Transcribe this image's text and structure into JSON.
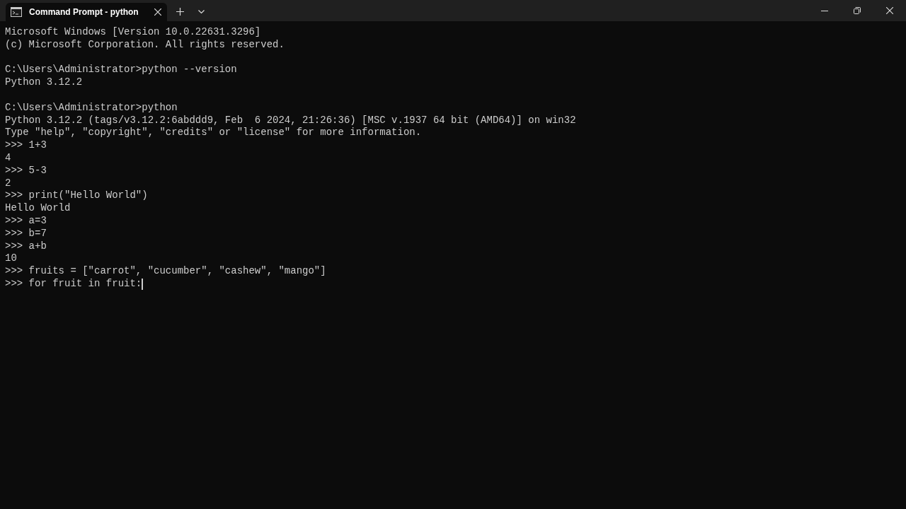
{
  "tabs": [
    {
      "title": "Command Prompt - python",
      "selected": true
    }
  ],
  "terminal": {
    "blocks": [
      [
        "Microsoft Windows [Version 10.0.22631.3296]",
        "(c) Microsoft Corporation. All rights reserved."
      ],
      [
        "C:\\Users\\Administrator>python --version",
        "Python 3.12.2"
      ],
      [
        "C:\\Users\\Administrator>python",
        "Python 3.12.2 (tags/v3.12.2:6abddd9, Feb  6 2024, 21:26:36) [MSC v.1937 64 bit (AMD64)] on win32",
        "Type \"help\", \"copyright\", \"credits\" or \"license\" for more information.",
        ">>> 1+3",
        "4",
        ">>> 5-3",
        "2",
        ">>> print(\"Hello World\")",
        "Hello World",
        ">>> a=3",
        ">>> b=7",
        ">>> a+b",
        "10",
        ">>> fruits = [\"carrot\", \"cucumber\", \"cashew\", \"mango\"]",
        ">>> for fruit in fruit:"
      ]
    ]
  }
}
